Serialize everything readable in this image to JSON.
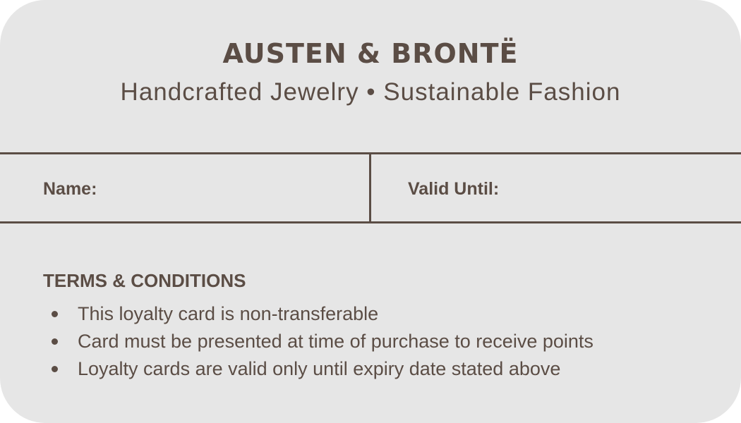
{
  "card": {
    "brand": "AUSTEN & BRONTË",
    "tagline": "Handcrafted Jewelry • Sustainable Fashion",
    "fields": {
      "name_label": "Name:",
      "valid_until_label": "Valid Until:"
    },
    "terms": {
      "heading": "TERMS & CONDITIONS",
      "items": [
        "This loyalty card is non-transferable",
        "Card must be presented at time of purchase to receive points",
        "Loyalty cards are valid only until expiry date stated above"
      ]
    },
    "colors": {
      "background": "#e6e6e6",
      "ink": "#5b4d45"
    }
  }
}
